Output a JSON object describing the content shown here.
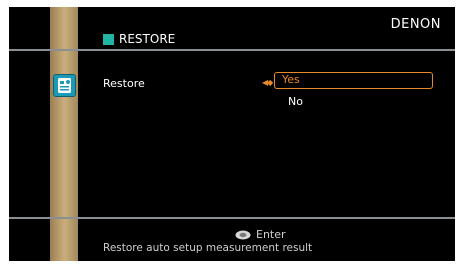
{
  "header": {
    "brand": "DENON",
    "title": "RESTORE"
  },
  "sidebar": {
    "section_icon": "setup-icon"
  },
  "setting": {
    "label": "Restore",
    "options": [
      "Yes",
      "No"
    ],
    "selected": "Yes"
  },
  "footer": {
    "enter_icon": "enter-button-icon",
    "enter_label": "Enter",
    "help_text": "Restore auto setup measurement result"
  },
  "colors": {
    "accent": "#e88a2a",
    "title_marker": "#22b5a6",
    "sidebar": "#c4a878",
    "background": "#000000"
  }
}
